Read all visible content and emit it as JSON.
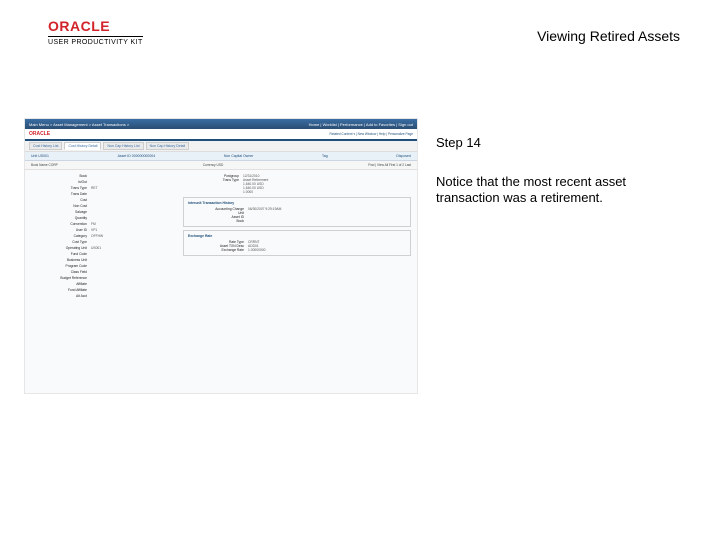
{
  "brand": {
    "logo": "ORACLE",
    "subline": "USER PRODUCTIVITY KIT"
  },
  "title": "Viewing Retired Assets",
  "step_label": "Step 14",
  "note": "Notice that the most recent asset transaction was a retirement.",
  "app": {
    "topbar_left": "Main Menu  >  Asset Management  >  Asset Transactions  >",
    "topbar_right": "Home | Worklist | Performance | Add to Favorites | Sign out",
    "logo": "ORACLE",
    "crumbs": "Related Content ▾ | New Window | Help | Personalize Page",
    "tabs": [
      "Cost History List",
      "Cost History Detail",
      "Non Cap History List",
      "Non Cap History Detail"
    ],
    "active_tab_index": 1,
    "bar2": {
      "unit_lbl": "Unit",
      "unit": "US001",
      "asset_lbl": "Asset ID",
      "asset": "000000000004",
      "desc": "Non Capital Owner",
      "tag_lbl": "Tag",
      "status_lbl": "Disposed"
    },
    "bar3": {
      "left": "Book Name  CORP",
      "mid": "Currency  USD",
      "right": "Find | View All   First  1 of 2  Last"
    },
    "left_fields": [
      {
        "k": "Book",
        "v": ""
      },
      {
        "k": "In/Out",
        "v": ""
      },
      {
        "k": "Trans Type",
        "v": "RET"
      },
      {
        "k": "Trans Date",
        "v": ""
      },
      {
        "k": "Cost",
        "v": ""
      },
      {
        "k": "Non Cost",
        "v": ""
      },
      {
        "k": "Salvage",
        "v": ""
      },
      {
        "k": "Quantity",
        "v": ""
      },
      {
        "k": "Convention",
        "v": "FM"
      },
      {
        "k": "User ID",
        "v": "VP1"
      },
      {
        "k": "Category",
        "v": "OFFHW"
      },
      {
        "k": "Cost Type",
        "v": ""
      },
      {
        "k": "Operating Unit",
        "v": "US001"
      },
      {
        "k": "Fund Code",
        "v": ""
      },
      {
        "k": "Business Unit",
        "v": ""
      },
      {
        "k": "Program Code",
        "v": ""
      },
      {
        "k": "Class Field",
        "v": ""
      },
      {
        "k": "Budget Reference",
        "v": ""
      },
      {
        "k": "Affiliate",
        "v": ""
      },
      {
        "k": "Fund Affiliate",
        "v": ""
      },
      {
        "k": "Alt Acct",
        "v": ""
      }
    ],
    "right_mid": [
      {
        "k": "Postgroup",
        "v": "12/31/2010"
      },
      {
        "k": "Trans Type",
        "v": "Asset Retirement"
      },
      {
        "k": "",
        "v": ""
      },
      {
        "k": "",
        "v": "1,640.00 USD"
      },
      {
        "k": "",
        "v": "1,640.00 USD"
      },
      {
        "k": "",
        "v": "1.0000"
      }
    ],
    "panel1": {
      "title": "Interunit Transaction History",
      "rows": [
        {
          "k": "Accounting Change",
          "v": "06/30/2007 9:29:19AM"
        },
        {
          "k": "Unit",
          "v": ""
        },
        {
          "k": "Asset ID",
          "v": ""
        },
        {
          "k": "Book",
          "v": ""
        }
      ]
    },
    "panel2": {
      "title": "Exchange Rate",
      "rows": [
        {
          "k": "Rate Type",
          "v": "CRRNT"
        },
        {
          "k": "Asset TXN Desc",
          "v": "ADD01"
        },
        {
          "k": "Exchange Rate",
          "v": "1.00000000"
        }
      ]
    }
  }
}
